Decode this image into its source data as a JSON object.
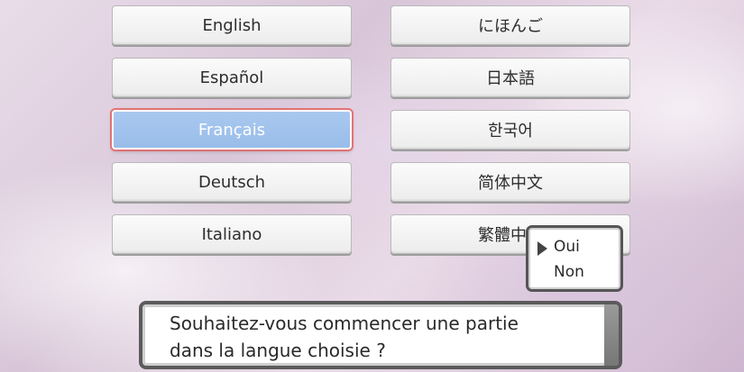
{
  "languages": {
    "left": [
      "English",
      "Español",
      "Français",
      "Deutsch",
      "Italiano"
    ],
    "right": [
      "にほんご",
      "日本語",
      "한국어",
      "简体中文",
      "繁體中文"
    ],
    "selected": "Français"
  },
  "choice_menu": {
    "options": [
      "Oui",
      "Non"
    ],
    "cursor_on": "Oui"
  },
  "dialog": {
    "line1": "Souhaitez-vous commencer une partie",
    "line2": "dans la langue choisie ?"
  },
  "colors": {
    "selected_fill": "#a9c8f0",
    "selected_outline": "#e27373"
  }
}
